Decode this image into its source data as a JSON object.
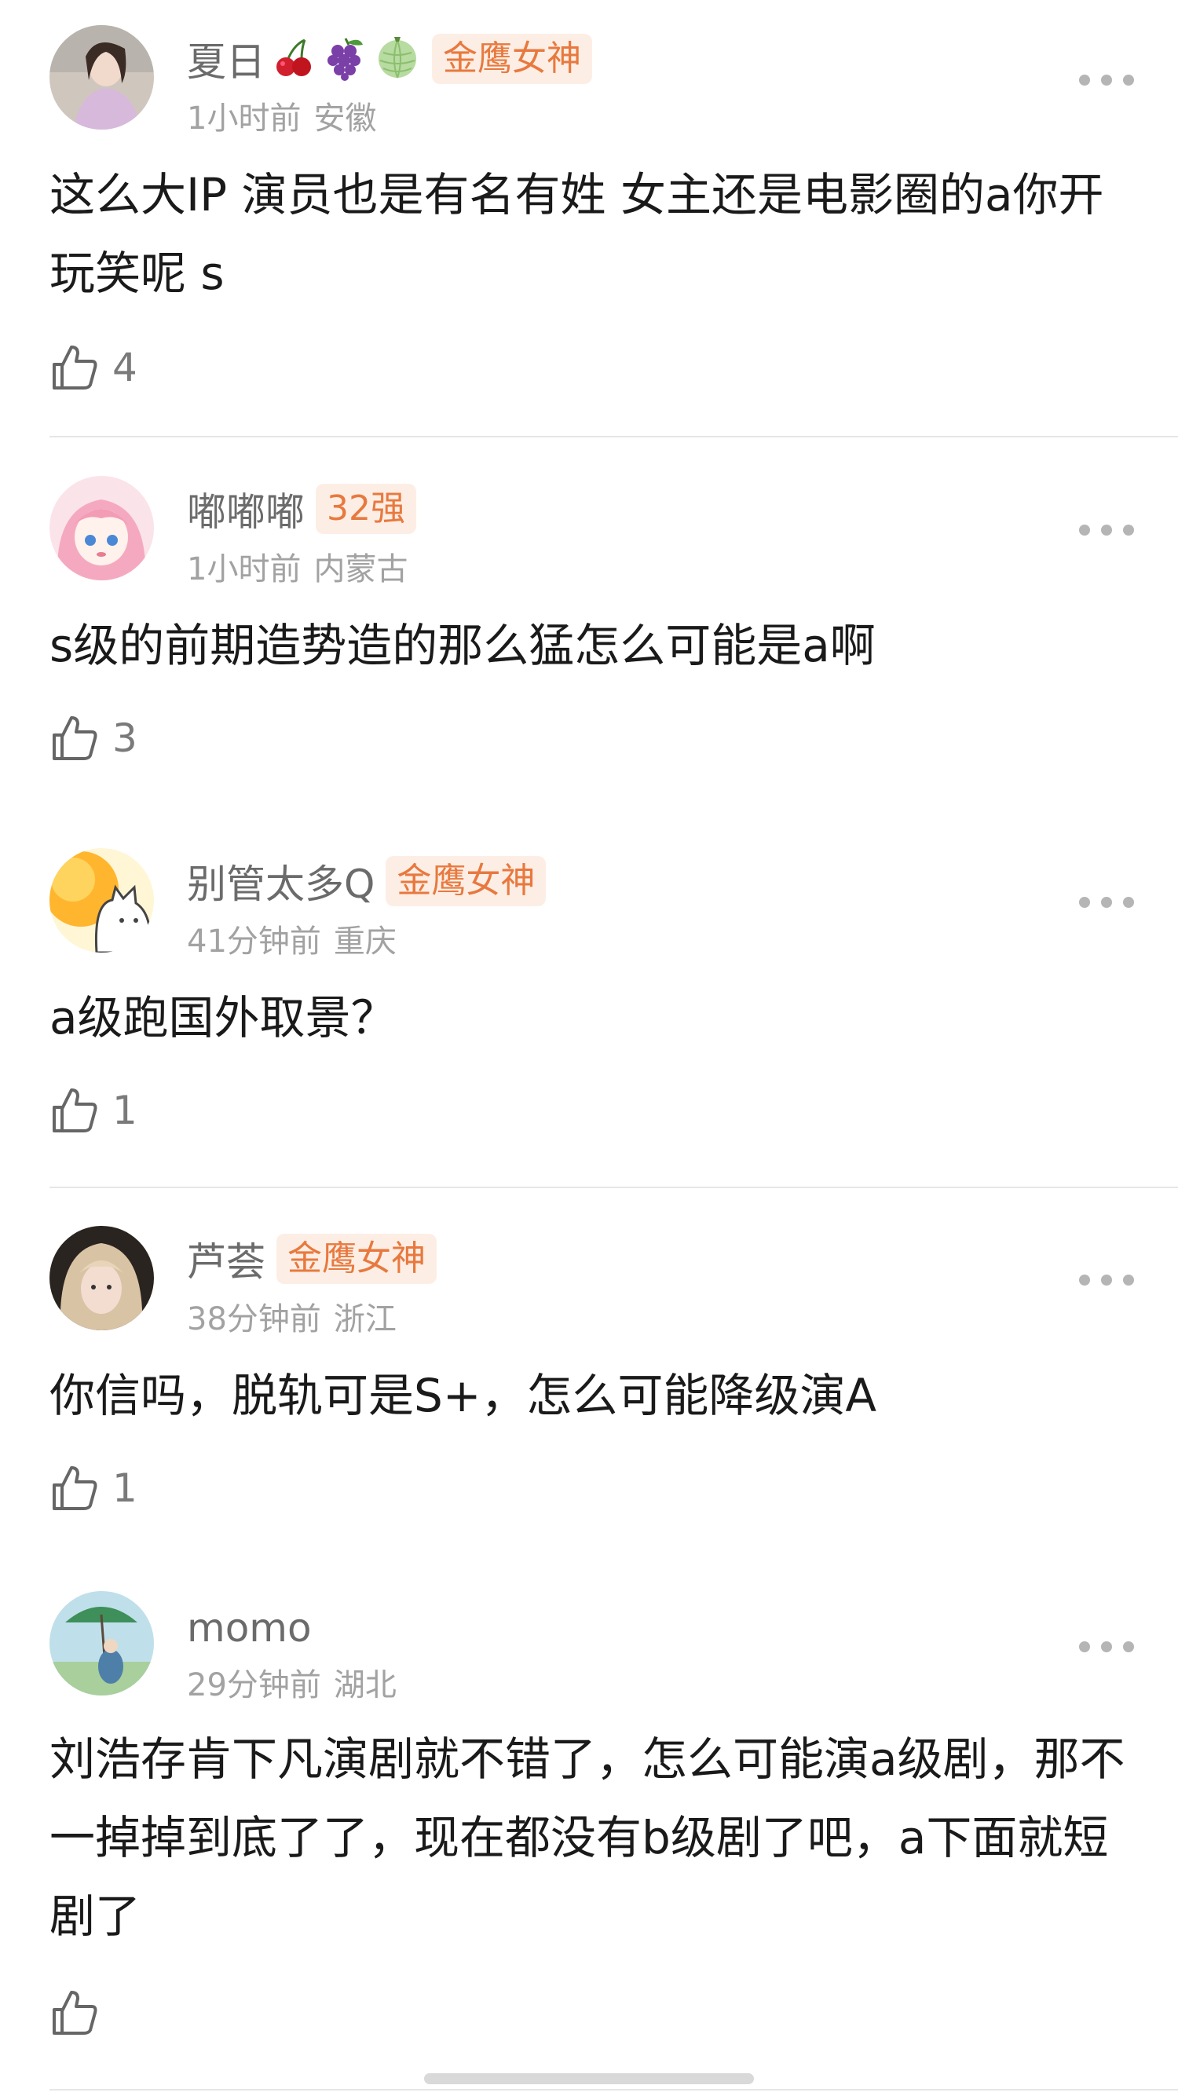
{
  "comments": [
    {
      "username": "夏日",
      "badge": "金鹰女神",
      "time": "1小时前",
      "location": "安徽",
      "text": "这么大IP 演员也是有名有姓 女主还是电影圈的a你开玩笑呢 s",
      "likes": "4",
      "emoji_icons": [
        "cherry-icon",
        "grapes-icon",
        "melon-icon"
      ]
    },
    {
      "username": "嘟嘟嘟",
      "badge": "32强",
      "time": "1小时前",
      "location": "内蒙古",
      "text": "s级的前期造势造的那么猛怎么可能是a啊",
      "likes": "3"
    },
    {
      "username": "别管太多Q",
      "badge": "金鹰女神",
      "time": "41分钟前",
      "location": "重庆",
      "text": "a级跑国外取景？",
      "likes": "1"
    },
    {
      "username": "芦荟",
      "badge": "金鹰女神",
      "time": "38分钟前",
      "location": "浙江",
      "text": "你信吗，脱轨可是S+，怎么可能降级演A",
      "likes": "1"
    },
    {
      "username": "momo",
      "badge": "",
      "time": "29分钟前",
      "location": "湖北",
      "text": "刘浩存肯下凡演剧就不错了，怎么可能演a级剧，那不一掉掉到底了了，现在都没有b级剧了吧，a下面就短剧了",
      "likes": ""
    }
  ],
  "colors": {
    "badge_text": "#e8793e",
    "badge_bg": "#fdeee5",
    "username": "#6b6b6b",
    "meta": "#a2a2a2",
    "divider": "#e6e6e6"
  }
}
